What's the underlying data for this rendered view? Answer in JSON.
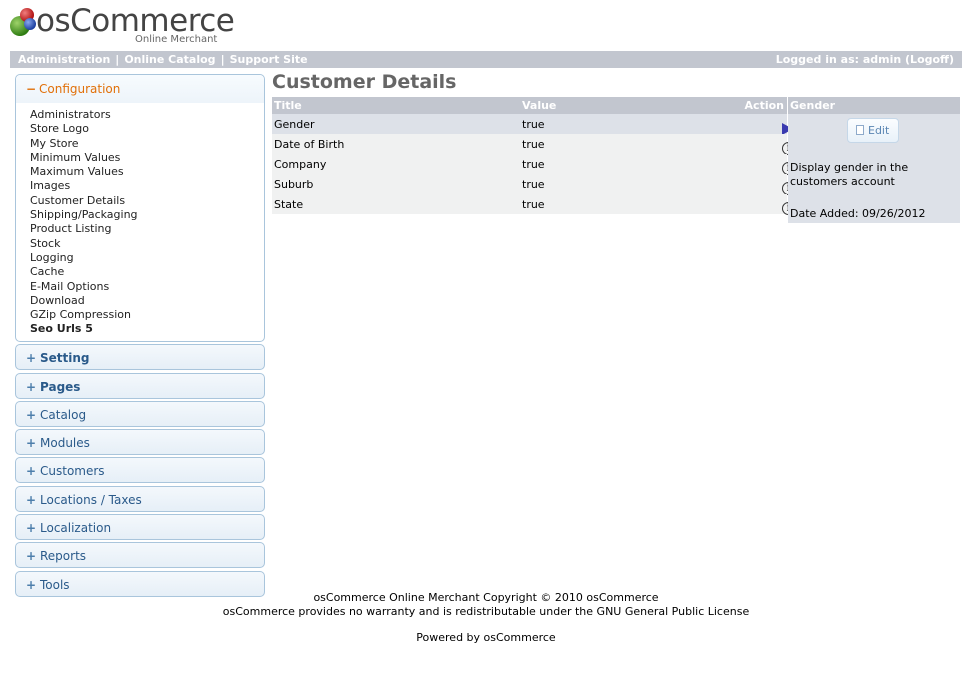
{
  "logo": {
    "name": "osCommerce",
    "subtitle": "Online Merchant"
  },
  "topbar": {
    "links": [
      "Administration",
      "Online Catalog",
      "Support Site"
    ],
    "separator": "|",
    "logged_in": "Logged in as: admin (Logoff)"
  },
  "sidebar": {
    "open_section": {
      "sign": "−",
      "label": "Configuration",
      "items": [
        "Administrators",
        "Store Logo",
        "My Store",
        "Minimum Values",
        "Maximum Values",
        "Images",
        "Customer Details",
        "Shipping/Packaging",
        "Product Listing",
        "Stock",
        "Logging",
        "Cache",
        "E-Mail Options",
        "Download",
        "GZip Compression",
        "Seo Urls 5"
      ],
      "active_item": "Seo Urls 5"
    },
    "sections": [
      {
        "sign": "+",
        "label": "Setting"
      },
      {
        "sign": "+",
        "label": "Pages"
      },
      {
        "sign": "+",
        "label": "Catalog"
      },
      {
        "sign": "+",
        "label": "Modules"
      },
      {
        "sign": "+",
        "label": "Customers"
      },
      {
        "sign": "+",
        "label": "Locations / Taxes"
      },
      {
        "sign": "+",
        "label": "Localization"
      },
      {
        "sign": "+",
        "label": "Reports"
      },
      {
        "sign": "+",
        "label": "Tools"
      }
    ]
  },
  "main": {
    "title": "Customer Details",
    "table": {
      "headers": {
        "title": "Title",
        "value": "Value",
        "action": "Action"
      },
      "rows": [
        {
          "title": "Gender",
          "value": "true",
          "action_icon": "arrow-right-icon",
          "selected": true
        },
        {
          "title": "Date of Birth",
          "value": "true",
          "action_icon": "info-icon"
        },
        {
          "title": "Company",
          "value": "true",
          "action_icon": "info-icon"
        },
        {
          "title": "Suburb",
          "value": "true",
          "action_icon": "info-icon"
        },
        {
          "title": "State",
          "value": "true",
          "action_icon": "info-icon"
        }
      ]
    },
    "info_box": {
      "heading": "Gender",
      "edit_label": "Edit",
      "description": "Display gender in the customers account",
      "date_added": "Date Added: 09/26/2012"
    }
  },
  "footer": {
    "line1": "osCommerce Online Merchant Copyright © 2010 osCommerce",
    "line2": "osCommerce provides no warranty and is redistributable under the GNU General Public License",
    "line3": "Powered by osCommerce"
  },
  "colors": {
    "bar": "#c2c6cf",
    "accent_orange": "#e17009",
    "link_blue": "#2a5a8a",
    "selected_row": "#dde1e8"
  }
}
